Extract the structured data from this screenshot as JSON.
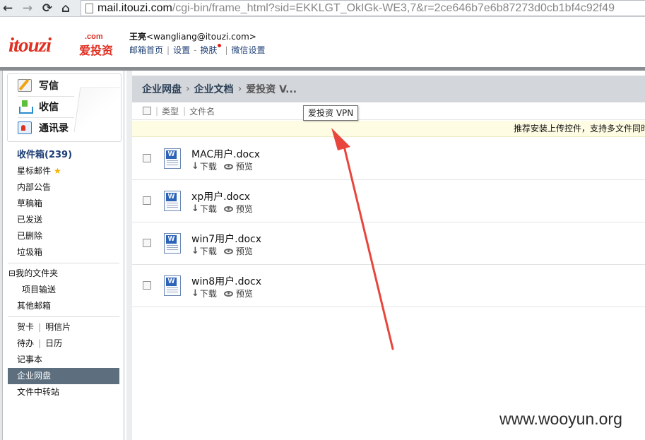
{
  "browser": {
    "url_host": "mail.itouzi.com",
    "url_path": "/cgi-bin/frame_html?sid=EKKLGT_OkIGk-WE3,7&r=2ce646b7e6b87273d0cb1bf4c92f49"
  },
  "header": {
    "logo_text": "itouzi",
    "logo_com": ".com",
    "logo_cn": "爱投资",
    "user_name": "王亮",
    "user_email": "<wangliang@itouzi.com>",
    "links": [
      "邮箱首页",
      "设置",
      "换肤",
      "微信设置"
    ]
  },
  "quick_actions": [
    {
      "label": "写信",
      "icon": "compose-icon"
    },
    {
      "label": "收信",
      "icon": "inbox-download-icon"
    },
    {
      "label": "通讯录",
      "icon": "contacts-icon"
    }
  ],
  "folders": {
    "inbox": "收件箱(239)",
    "starred": "星标邮件",
    "notice": "内部公告",
    "drafts": "草稿箱",
    "sent": "已发送",
    "deleted": "已删除",
    "spam": "垃圾箱",
    "my_folders": "我的文件夹",
    "tree_toggle": "⊟",
    "project": "项目输送",
    "other_mail": "其他邮箱",
    "cards": "贺卡",
    "postcards": "明信片",
    "todo": "待办",
    "calendar": "日历",
    "notes": "记事本",
    "disk": "企业网盘",
    "transfer": "文件中转站"
  },
  "main": {
    "breadcrumb": [
      "企业网盘",
      "企业文档",
      "爱投资 V..."
    ],
    "columns": {
      "type": "类型",
      "name": "文件名"
    },
    "notice_text": "推荐安装上传控件，支持多文件同时上",
    "tooltip": "爱投资  VPN",
    "download_label": "下载",
    "preview_label": "预览",
    "files": [
      {
        "name": "MAC用户.docx"
      },
      {
        "name": "xp用户.docx"
      },
      {
        "name": "win7用户.docx"
      },
      {
        "name": "win8用户.docx"
      }
    ]
  },
  "watermark": "www.wooyun.org",
  "colors": {
    "brand_red": "#e03022",
    "active_bg": "#5d6f7f",
    "arrow": "#e8453c"
  }
}
